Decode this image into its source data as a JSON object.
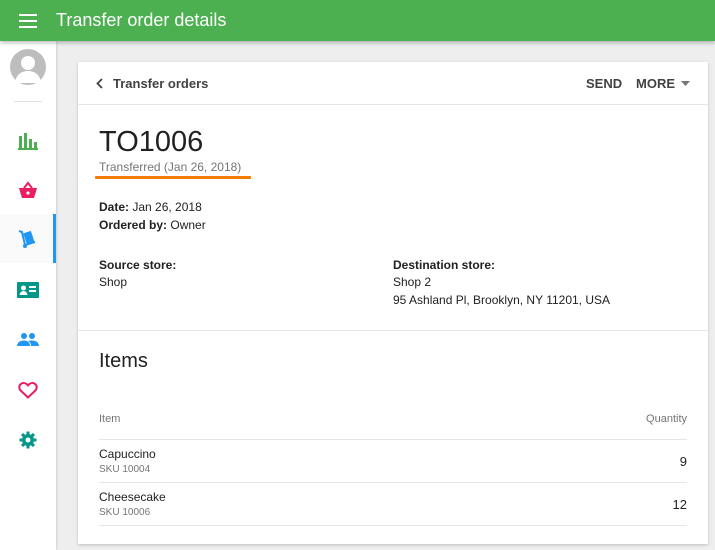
{
  "app": {
    "title": "Transfer order details",
    "primary_color": "#4caf50",
    "accent_color": "#2196f3",
    "status_underline_color": "#f57c00"
  },
  "sidebar": {
    "items": [
      {
        "name": "reports",
        "icon": "bar-chart-icon",
        "active": false
      },
      {
        "name": "items",
        "icon": "basket-icon",
        "active": false
      },
      {
        "name": "inventory",
        "icon": "hand-truck-icon",
        "active": true
      },
      {
        "name": "employees",
        "icon": "id-card-icon",
        "active": false
      },
      {
        "name": "customers",
        "icon": "people-icon",
        "active": false
      },
      {
        "name": "loyalty",
        "icon": "heart-icon",
        "active": false
      },
      {
        "name": "settings",
        "icon": "gear-icon",
        "active": false
      }
    ]
  },
  "card": {
    "back_label": "Transfer orders",
    "send_label": "SEND",
    "more_label": "MORE"
  },
  "order": {
    "id": "TO1006",
    "status": "Transferred (Jan 26, 2018)",
    "date_label": "Date:",
    "date_value": "Jan 26, 2018",
    "ordered_by_label": "Ordered by:",
    "ordered_by_value": "Owner",
    "source_label": "Source store:",
    "source_value": "Shop",
    "destination_label": "Destination store:",
    "destination_name": "Shop 2",
    "destination_address": "95 Ashland Pl, Brooklyn, NY 11201, USA"
  },
  "items_section": {
    "title": "Items",
    "col_item": "Item",
    "col_quantity": "Quantity",
    "rows": [
      {
        "name": "Capuccino",
        "sku": "SKU 10004",
        "quantity": "9"
      },
      {
        "name": "Cheesecake",
        "sku": "SKU 10006",
        "quantity": "12"
      }
    ]
  }
}
